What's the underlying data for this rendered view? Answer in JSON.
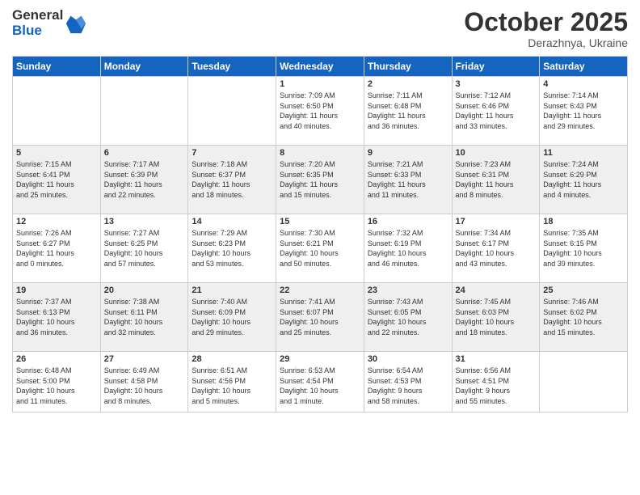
{
  "logo": {
    "general": "General",
    "blue": "Blue"
  },
  "title": "October 2025",
  "location": "Derazhnya, Ukraine",
  "days_header": [
    "Sunday",
    "Monday",
    "Tuesday",
    "Wednesday",
    "Thursday",
    "Friday",
    "Saturday"
  ],
  "weeks": [
    [
      {
        "day": "",
        "info": ""
      },
      {
        "day": "",
        "info": ""
      },
      {
        "day": "",
        "info": ""
      },
      {
        "day": "1",
        "info": "Sunrise: 7:09 AM\nSunset: 6:50 PM\nDaylight: 11 hours\nand 40 minutes."
      },
      {
        "day": "2",
        "info": "Sunrise: 7:11 AM\nSunset: 6:48 PM\nDaylight: 11 hours\nand 36 minutes."
      },
      {
        "day": "3",
        "info": "Sunrise: 7:12 AM\nSunset: 6:46 PM\nDaylight: 11 hours\nand 33 minutes."
      },
      {
        "day": "4",
        "info": "Sunrise: 7:14 AM\nSunset: 6:43 PM\nDaylight: 11 hours\nand 29 minutes."
      }
    ],
    [
      {
        "day": "5",
        "info": "Sunrise: 7:15 AM\nSunset: 6:41 PM\nDaylight: 11 hours\nand 25 minutes."
      },
      {
        "day": "6",
        "info": "Sunrise: 7:17 AM\nSunset: 6:39 PM\nDaylight: 11 hours\nand 22 minutes."
      },
      {
        "day": "7",
        "info": "Sunrise: 7:18 AM\nSunset: 6:37 PM\nDaylight: 11 hours\nand 18 minutes."
      },
      {
        "day": "8",
        "info": "Sunrise: 7:20 AM\nSunset: 6:35 PM\nDaylight: 11 hours\nand 15 minutes."
      },
      {
        "day": "9",
        "info": "Sunrise: 7:21 AM\nSunset: 6:33 PM\nDaylight: 11 hours\nand 11 minutes."
      },
      {
        "day": "10",
        "info": "Sunrise: 7:23 AM\nSunset: 6:31 PM\nDaylight: 11 hours\nand 8 minutes."
      },
      {
        "day": "11",
        "info": "Sunrise: 7:24 AM\nSunset: 6:29 PM\nDaylight: 11 hours\nand 4 minutes."
      }
    ],
    [
      {
        "day": "12",
        "info": "Sunrise: 7:26 AM\nSunset: 6:27 PM\nDaylight: 11 hours\nand 0 minutes."
      },
      {
        "day": "13",
        "info": "Sunrise: 7:27 AM\nSunset: 6:25 PM\nDaylight: 10 hours\nand 57 minutes."
      },
      {
        "day": "14",
        "info": "Sunrise: 7:29 AM\nSunset: 6:23 PM\nDaylight: 10 hours\nand 53 minutes."
      },
      {
        "day": "15",
        "info": "Sunrise: 7:30 AM\nSunset: 6:21 PM\nDaylight: 10 hours\nand 50 minutes."
      },
      {
        "day": "16",
        "info": "Sunrise: 7:32 AM\nSunset: 6:19 PM\nDaylight: 10 hours\nand 46 minutes."
      },
      {
        "day": "17",
        "info": "Sunrise: 7:34 AM\nSunset: 6:17 PM\nDaylight: 10 hours\nand 43 minutes."
      },
      {
        "day": "18",
        "info": "Sunrise: 7:35 AM\nSunset: 6:15 PM\nDaylight: 10 hours\nand 39 minutes."
      }
    ],
    [
      {
        "day": "19",
        "info": "Sunrise: 7:37 AM\nSunset: 6:13 PM\nDaylight: 10 hours\nand 36 minutes."
      },
      {
        "day": "20",
        "info": "Sunrise: 7:38 AM\nSunset: 6:11 PM\nDaylight: 10 hours\nand 32 minutes."
      },
      {
        "day": "21",
        "info": "Sunrise: 7:40 AM\nSunset: 6:09 PM\nDaylight: 10 hours\nand 29 minutes."
      },
      {
        "day": "22",
        "info": "Sunrise: 7:41 AM\nSunset: 6:07 PM\nDaylight: 10 hours\nand 25 minutes."
      },
      {
        "day": "23",
        "info": "Sunrise: 7:43 AM\nSunset: 6:05 PM\nDaylight: 10 hours\nand 22 minutes."
      },
      {
        "day": "24",
        "info": "Sunrise: 7:45 AM\nSunset: 6:03 PM\nDaylight: 10 hours\nand 18 minutes."
      },
      {
        "day": "25",
        "info": "Sunrise: 7:46 AM\nSunset: 6:02 PM\nDaylight: 10 hours\nand 15 minutes."
      }
    ],
    [
      {
        "day": "26",
        "info": "Sunrise: 6:48 AM\nSunset: 5:00 PM\nDaylight: 10 hours\nand 11 minutes."
      },
      {
        "day": "27",
        "info": "Sunrise: 6:49 AM\nSunset: 4:58 PM\nDaylight: 10 hours\nand 8 minutes."
      },
      {
        "day": "28",
        "info": "Sunrise: 6:51 AM\nSunset: 4:56 PM\nDaylight: 10 hours\nand 5 minutes."
      },
      {
        "day": "29",
        "info": "Sunrise: 6:53 AM\nSunset: 4:54 PM\nDaylight: 10 hours\nand 1 minute."
      },
      {
        "day": "30",
        "info": "Sunrise: 6:54 AM\nSunset: 4:53 PM\nDaylight: 9 hours\nand 58 minutes."
      },
      {
        "day": "31",
        "info": "Sunrise: 6:56 AM\nSunset: 4:51 PM\nDaylight: 9 hours\nand 55 minutes."
      },
      {
        "day": "",
        "info": ""
      }
    ]
  ]
}
